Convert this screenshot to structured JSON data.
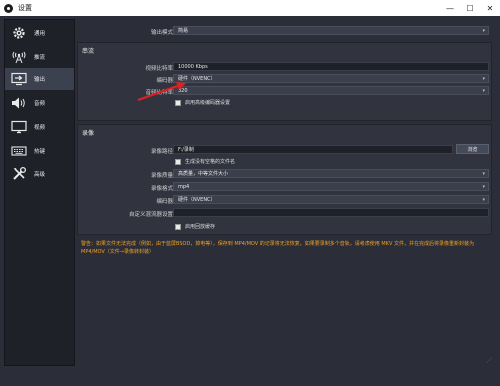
{
  "window": {
    "title": "设置"
  },
  "sidebar": {
    "items": [
      {
        "label": "通用",
        "icon": "gear-icon"
      },
      {
        "label": "推流",
        "icon": "antenna-icon"
      },
      {
        "label": "输出",
        "icon": "output-icon",
        "active": true
      },
      {
        "label": "音频",
        "icon": "speaker-icon"
      },
      {
        "label": "视频",
        "icon": "monitor-icon"
      },
      {
        "label": "热键",
        "icon": "keyboard-icon"
      },
      {
        "label": "高级",
        "icon": "tools-icon"
      }
    ]
  },
  "output": {
    "mode_label": "输出模式",
    "mode_value": "简易"
  },
  "streaming": {
    "title": "串流",
    "bitrate_label": "视频比特率",
    "bitrate_value": "10000 Kbps",
    "encoder_label": "编码器",
    "encoder_value": "硬件（NVENC）",
    "audio_bitrate_label": "音频比特率",
    "audio_bitrate_value": "320",
    "advanced_encoder_label": "启用高级编码器设置"
  },
  "recording": {
    "title": "录像",
    "path_label": "录像路径",
    "path_value": "F:/录制",
    "browse_label": "浏览",
    "no_space_label": "生成没有空格的文件名",
    "quality_label": "录像质量",
    "quality_value": "高质量，中等文件大小",
    "format_label": "录像格式",
    "format_value": "mp4",
    "encoder_label": "编码器",
    "encoder_value": "硬件（NVENC）",
    "muxer_label": "自定义混流器设置",
    "muxer_value": "",
    "replay_buffer_label": "启用回放缓存"
  },
  "warning": {
    "text": "警告：如果文件无法完成（例如，由于蓝屏BSOD，掉电等），保存到 MP4/MOV 的记录将无法恢复。如果要录制多个音轨，请考虑使用 MKV 文件，并在完成后将录像重新封装为 MP4/MOV（文件→录像转封装）"
  },
  "colors": {
    "accent": "#f0a020",
    "active_nav": "#3c4150",
    "arrow": "#e02020"
  }
}
